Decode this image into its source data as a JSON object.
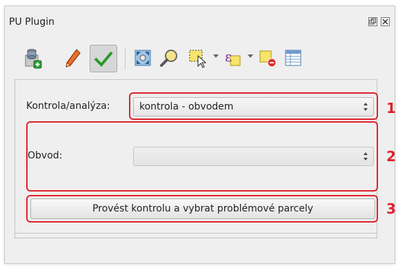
{
  "window": {
    "title": "PU Plugin",
    "float_icon": "float-icon",
    "close_icon": "close-icon"
  },
  "toolbar": {
    "icons": [
      "database-add-icon",
      "pencil-icon",
      "checkmark-icon",
      "zoom-extent-icon",
      "zoom-icon",
      "select-rectangle-icon",
      "select-expression-icon",
      "deselect-icon",
      "attribute-table-icon"
    ],
    "active_tool": "checkmark-icon"
  },
  "form": {
    "analysis_label": "Kontrola/analýza:",
    "analysis_value": "kontrola - obvodem",
    "perimeter_label": "Obvod:",
    "perimeter_value": "",
    "run_button_label": "Provést kontrolu a vybrat problémové parcely"
  },
  "annotations": [
    "1",
    "2",
    "3"
  ],
  "colors": {
    "highlight": "#e0202a",
    "panel_bg": "#efefef"
  }
}
